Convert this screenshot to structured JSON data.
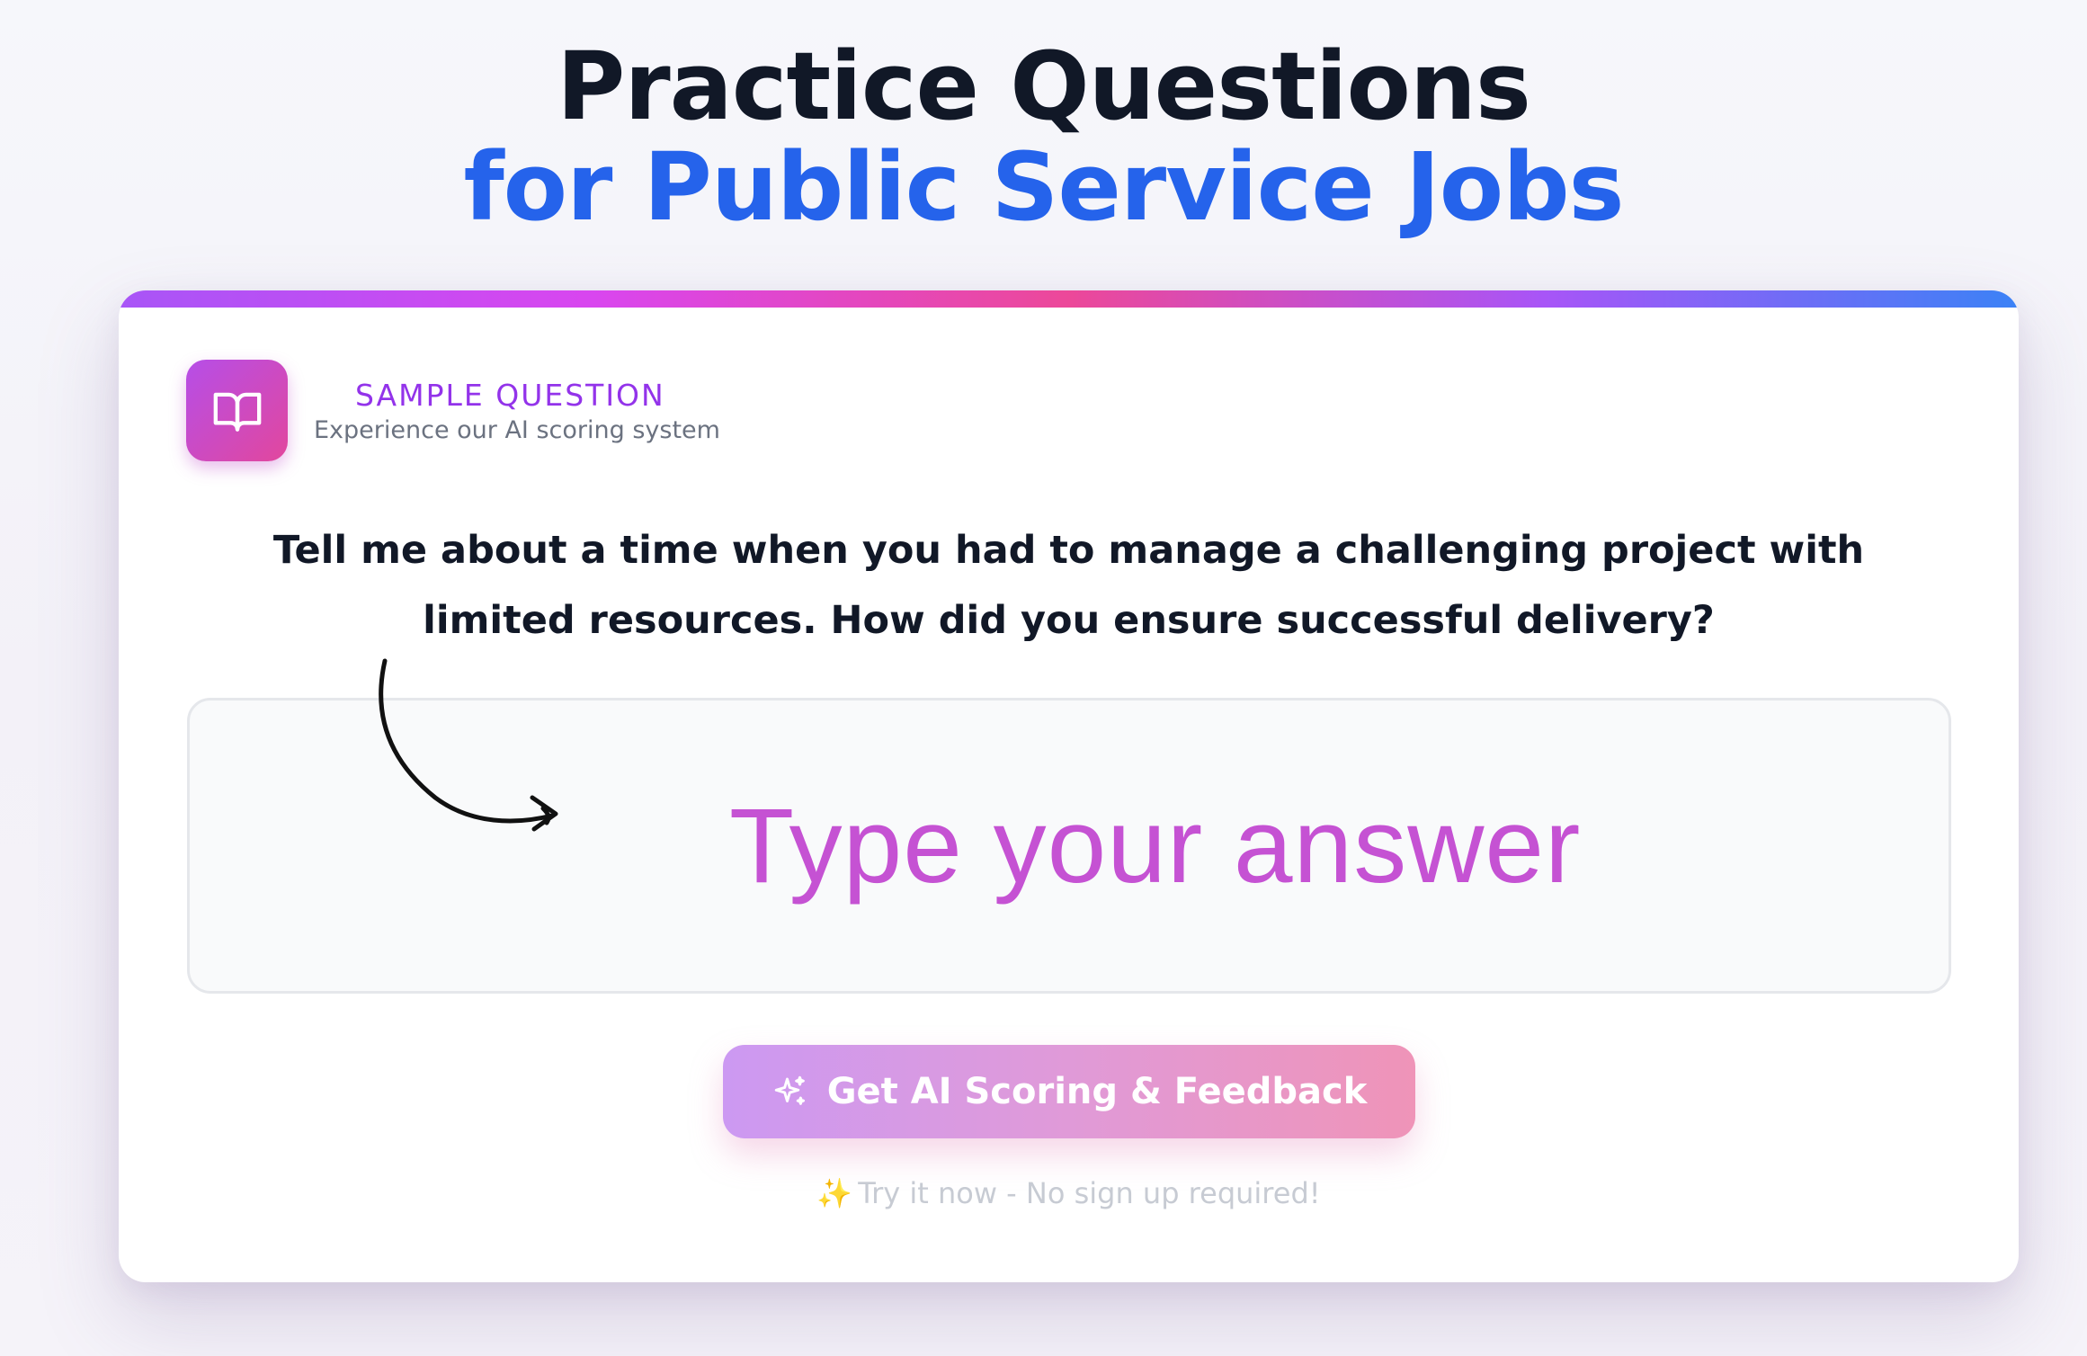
{
  "hero": {
    "line1": "Practice Questions",
    "line2": "for Public Service Jobs"
  },
  "card": {
    "badge_icon": "book-open-icon",
    "eyebrow": "SAMPLE QUESTION",
    "eyebrow_sub": "Experience our AI scoring system",
    "question": "Tell me about a time when you had to manage a challenging project with limited resources. How did you ensure successful delivery?",
    "answer_placeholder": "Type your answer",
    "cta_icon": "sparkles-icon",
    "cta_label": "Get AI Scoring & Feedback",
    "footnote_icon": "✨",
    "footnote": "Try it now - No sign up required!"
  },
  "colors": {
    "heading": "#111827",
    "accent_blue": "#2563eb",
    "accent_purple": "#9333ea",
    "placeholder": "#c552d3"
  }
}
